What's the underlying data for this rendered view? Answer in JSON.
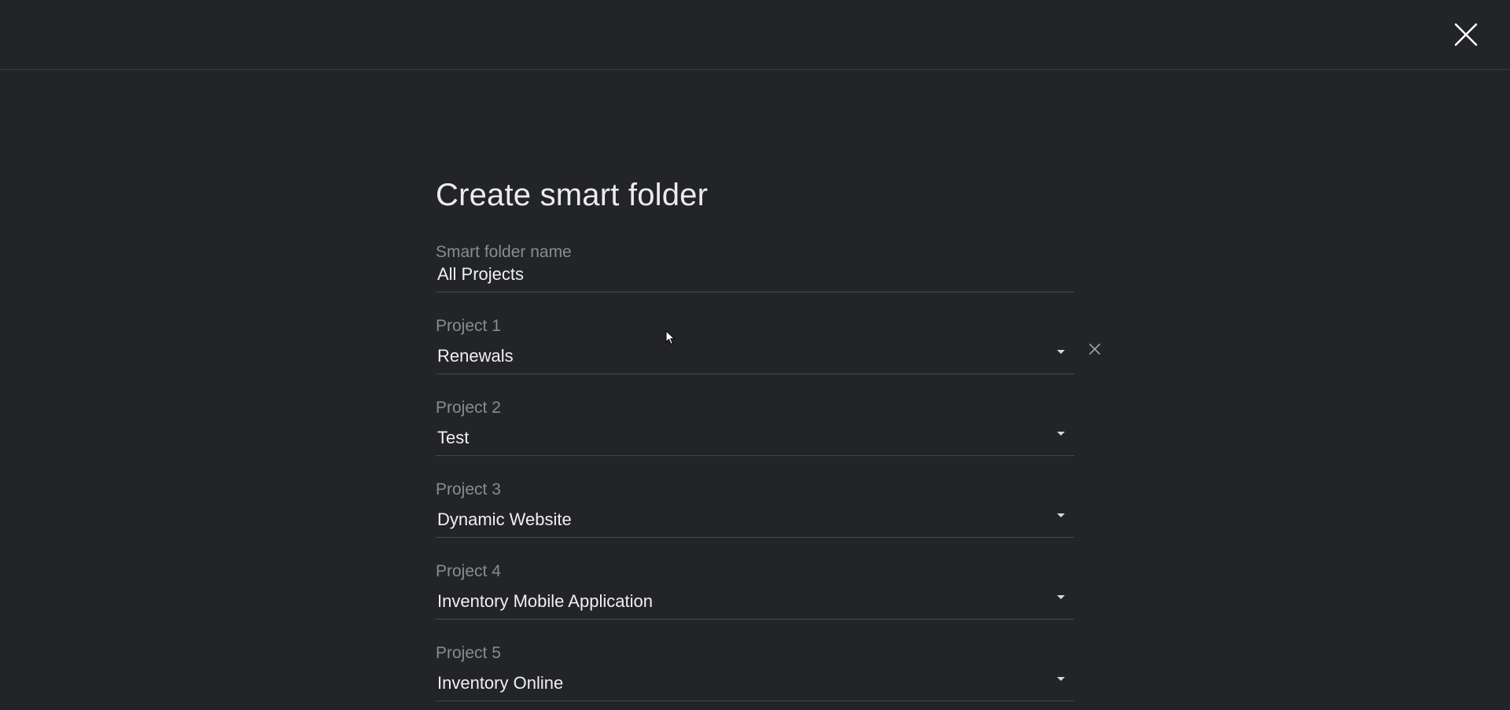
{
  "dialog": {
    "title": "Create smart folder"
  },
  "name_field": {
    "label": "Smart folder name",
    "value": "All Projects"
  },
  "projects": [
    {
      "label": "Project 1",
      "value": "Renewals"
    },
    {
      "label": "Project 2",
      "value": "Test"
    },
    {
      "label": "Project 3",
      "value": "Dynamic Website"
    },
    {
      "label": "Project 4",
      "value": "Inventory Mobile Application"
    },
    {
      "label": "Project 5",
      "value": "Inventory Online"
    }
  ],
  "icons": {
    "close": "close-icon",
    "remove": "remove-icon",
    "dropdown": "chevron-down-icon"
  },
  "colors": {
    "background": "#232428",
    "text": "#f0f0f1",
    "label": "#8a8b90",
    "divider": "#46474c"
  }
}
